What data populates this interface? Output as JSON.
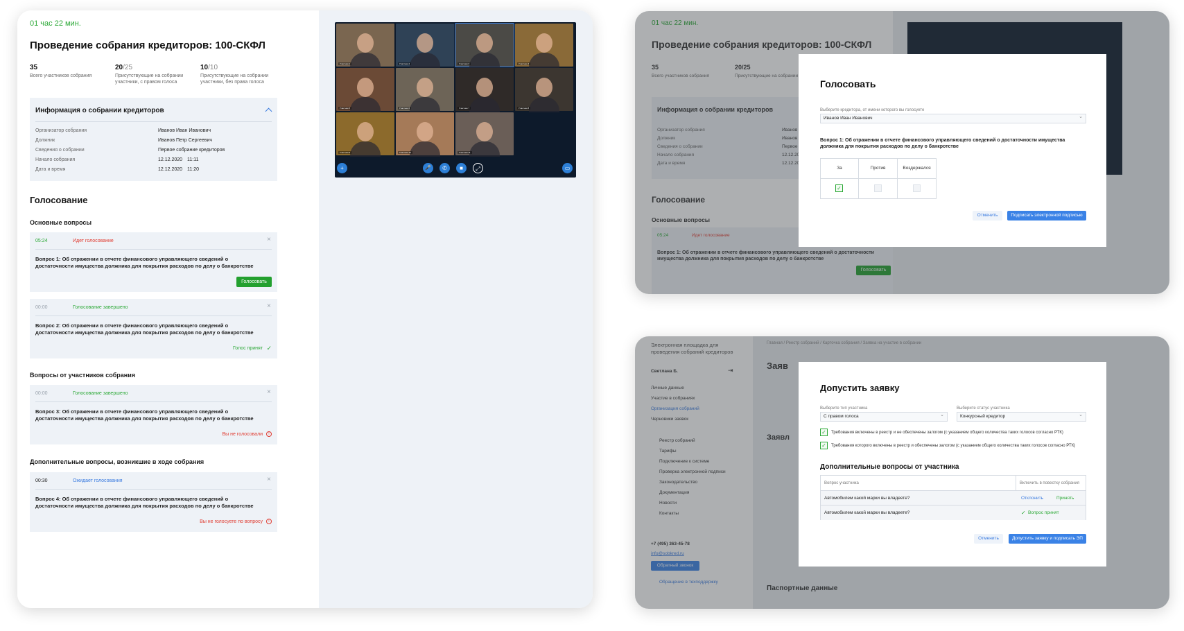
{
  "main": {
    "timer": "01 час 22 мин.",
    "title": "Проведение собрания кредиторов:  100-СКФЛ",
    "stats": [
      {
        "num": "35",
        "sub": "",
        "label": "Всего участников собрания"
      },
      {
        "num": "20",
        "sub": "/25",
        "label": "Присутствующие на собрании участники, с правом голоса"
      },
      {
        "num": "10",
        "sub": "/10",
        "label": "Присутствующие на собрании участники, без права голоса"
      }
    ],
    "info": {
      "title": "Информация о собрании кредиторов",
      "rows": [
        {
          "label": "Организатор собрания",
          "value": "Иванов Иван Иванович",
          "value2": ""
        },
        {
          "label": "Должник",
          "value": "Иванов Петр Сергеевич",
          "value2": ""
        },
        {
          "label": "Сведения о собрании",
          "value": "Первое собрание кредиторов",
          "value2": ""
        },
        {
          "label": "Начало собрания",
          "value": "12.12.2020",
          "value2": "11:11"
        },
        {
          "label": "Дата и время",
          "value": "12.12.2020",
          "value2": "11:20"
        }
      ]
    },
    "voting_title": "Голосование",
    "sec_main": "Основные вопросы",
    "sec_members": "Вопросы от участников собрания",
    "sec_extra": "Дополнительные вопросы, возникшие  в ходе собрания",
    "q1": {
      "time": "05:24",
      "status": "Идет голосование",
      "text": "Вопрос 1: Об отражении в отчете финансового управляющего сведений о достаточности имущества должника для покрытия расходов по делу о банкротстве",
      "action": "Голосовать"
    },
    "q2": {
      "time": "00:00",
      "status": "Голосование завершено",
      "text": "Вопрос 2: Об отражении в отчете финансового управляющего сведений о достаточности имущества должника для покрытия расходов по делу о банкротстве",
      "result": "Голос принят"
    },
    "q3": {
      "time": "00:00",
      "status": "Голосование завершено",
      "text": "Вопрос 3: Об отражении в отчете финансового управляющего сведений о достаточности имущества должника для покрытия расходов по делу о банкротстве",
      "result": "Вы не голосовали"
    },
    "q4": {
      "time": "00:30",
      "status": "Ожидает голосования",
      "text": "Вопрос 4: Об отражении в отчете финансового управляющего сведений о достаточности имущества должника для покрытия расходов по делу о банкротстве",
      "result": "Вы не голосуете по вопросу"
    },
    "close_glyph": "×",
    "check_glyph": "✓",
    "warn_glyph": "!"
  },
  "video": {
    "participants": [
      "Участник 1",
      "Участник 2",
      "Участник 3",
      "Участник 4",
      "Участник 5",
      "Участник 6",
      "Участник 7",
      "Участник 8",
      "Участник 9",
      "Участник 10",
      "Участник 11"
    ],
    "controls": {
      "add": "+",
      "mic": "🎤",
      "phone": "✆",
      "cam": "■",
      "share": "⤢",
      "chat": "▭"
    }
  },
  "vote_modal": {
    "bg_timer": "01 час 22 мин.",
    "bg_title": "Проведение собрания кредиторов:  100-СКФЛ",
    "bg_stat1": "35",
    "bg_stat1_label": "Всего участников собрания",
    "bg_stat2": "20/25",
    "bg_stat2_label": "Присутствующие на собрании",
    "bg_info": "Информация о собрании кредиторов",
    "bg_rows": [
      "Организатор собрания",
      "Должник",
      "Сведения о собрании",
      "Начало собрания",
      "Дата и время"
    ],
    "bg_vals": [
      "Иванов И",
      "Иванов П",
      "Первое с",
      "12.12.20",
      "12.12.20"
    ],
    "bg_voting": "Голосование",
    "bg_sec": "Основные вопросы",
    "bg_time": "05:24",
    "bg_status": "Идет голосование",
    "bg_q": "Вопрос 1: Об отражении в отчете финансового управляющего сведений о достаточности имущества должника для покрытия расходов по делу о банкротстве",
    "bg_btn": "Голосовать",
    "title": "Голосовать",
    "creditor_label": "Выберите кредитора, от имени которого вы голосуете",
    "creditor_value": "Иванов Иван Иванович",
    "question": "Вопрос 1: Об отражении в отчете финансового управляющего сведений о достаточности имущества должника для покрытия расходов по делу о банкротстве",
    "options": [
      "За",
      "Против",
      "Воздержался"
    ],
    "cancel": "Отменить",
    "sign": "Подписать электронной подписью"
  },
  "admit_modal": {
    "brand": "Электронная площадка для проведения собраний кредиторов",
    "crumbs": "Главная  /  Реестр собраний  /  Карточка собрания  /  Заявка на участие в собрании",
    "user": "Светлана Б.",
    "logout_icon": "⇥",
    "menu_top": [
      "Личные данные",
      "Участие в собраниях",
      "Организация собраний",
      "Черновики заявок"
    ],
    "menu_bottom": [
      "Реестр собраний",
      "Тарифы",
      "Подключение к системе",
      "Проверка электронной подписи",
      "Законодательство",
      "Документация",
      "Новости",
      "Контакты"
    ],
    "phone": "+7 (495) 363-45-78",
    "email": "info@sobkred.ru",
    "callback": "Обратный звонок",
    "support": "Обращение в техподдержку",
    "bg_heading": "Заяв",
    "bg_heading2": "Заявл",
    "bg_passport": "Паспортные данные",
    "title": "Допустить заявку",
    "type_label": "Выберите тип участника",
    "type_value": "С правом голоса",
    "status_label": "Выберите статус участника",
    "status_value": "Конкурсный кредитор",
    "req1": "Требования включены в реестр и не обеспечены залогом (с указанием общего количества таких голосов согласно РТК)",
    "req2": "Требования которого включены в реестр и обеспечены залогом (с указанием общего количества таких голосов согласно РТК)",
    "extra_title": "Дополнительные вопросы от участника",
    "col1": "Вопрос участника",
    "col2": "Включить в повестку собрания",
    "rows": [
      {
        "q": "Автомобилем какой марки вы владеете?",
        "reject": "Отклонить",
        "accept": "Принять"
      },
      {
        "q": "Автомобилем какой марки вы владеете?",
        "result": "Вопрос принят"
      }
    ],
    "cancel": "Отменить",
    "submit": "Допустить заявку и подписать ЭП"
  }
}
